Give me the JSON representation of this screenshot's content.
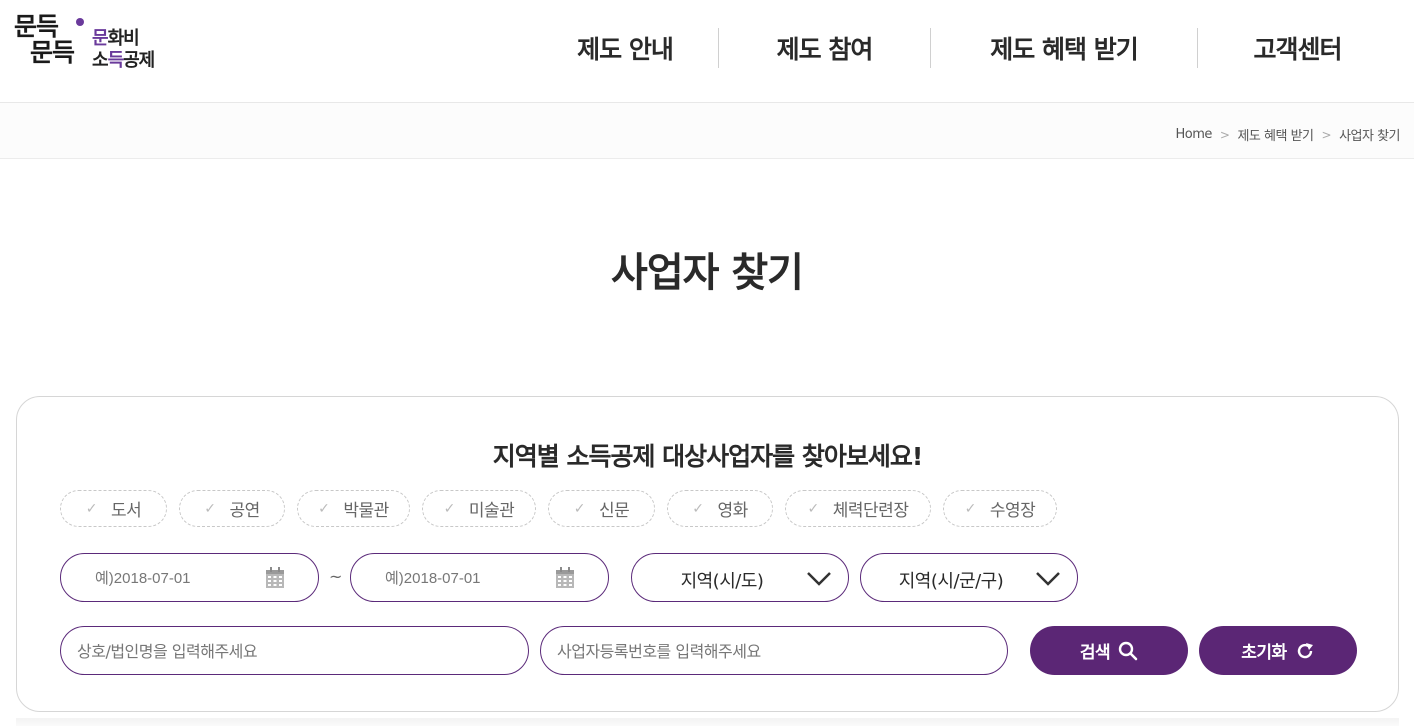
{
  "logo": {
    "mark_line1": "문득",
    "mark_line2": "문득",
    "text_line1_hl": "문",
    "text_line1_rest": "화비",
    "text_line2_pre": "소",
    "text_line2_hl": "득",
    "text_line2_rest": "공제"
  },
  "nav": {
    "items": [
      "제도 안내",
      "제도 참여",
      "제도 혜택 받기",
      "고객센터"
    ]
  },
  "breadcrumb": {
    "items": [
      "Home",
      "제도 혜택 받기",
      "사업자 찾기"
    ],
    "separator": ">"
  },
  "page": {
    "title": "사업자 찾기"
  },
  "search": {
    "heading": "지역별 소득공제 대상사업자를 찾아보세요!",
    "categories": [
      "도서",
      "공연",
      "박물관",
      "미술관",
      "신문",
      "영화",
      "체력단련장",
      "수영장"
    ],
    "check_glyph": "✓",
    "date_from_placeholder": "예)2018-07-01",
    "date_to_placeholder": "예)2018-07-01",
    "range_separator": "~",
    "region_sido": "지역(시/도)",
    "region_sigungu": "지역(시/군/구)",
    "name_placeholder": "상호/법인명을 입력해주세요",
    "bizno_placeholder": "사업자등록번호를 입력해주세요",
    "search_button": "검색",
    "reset_button": "초기화"
  },
  "colors": {
    "accent": "#5b2675",
    "border_accent": "#5b2a7a",
    "logo_highlight": "#6a3a9b"
  }
}
